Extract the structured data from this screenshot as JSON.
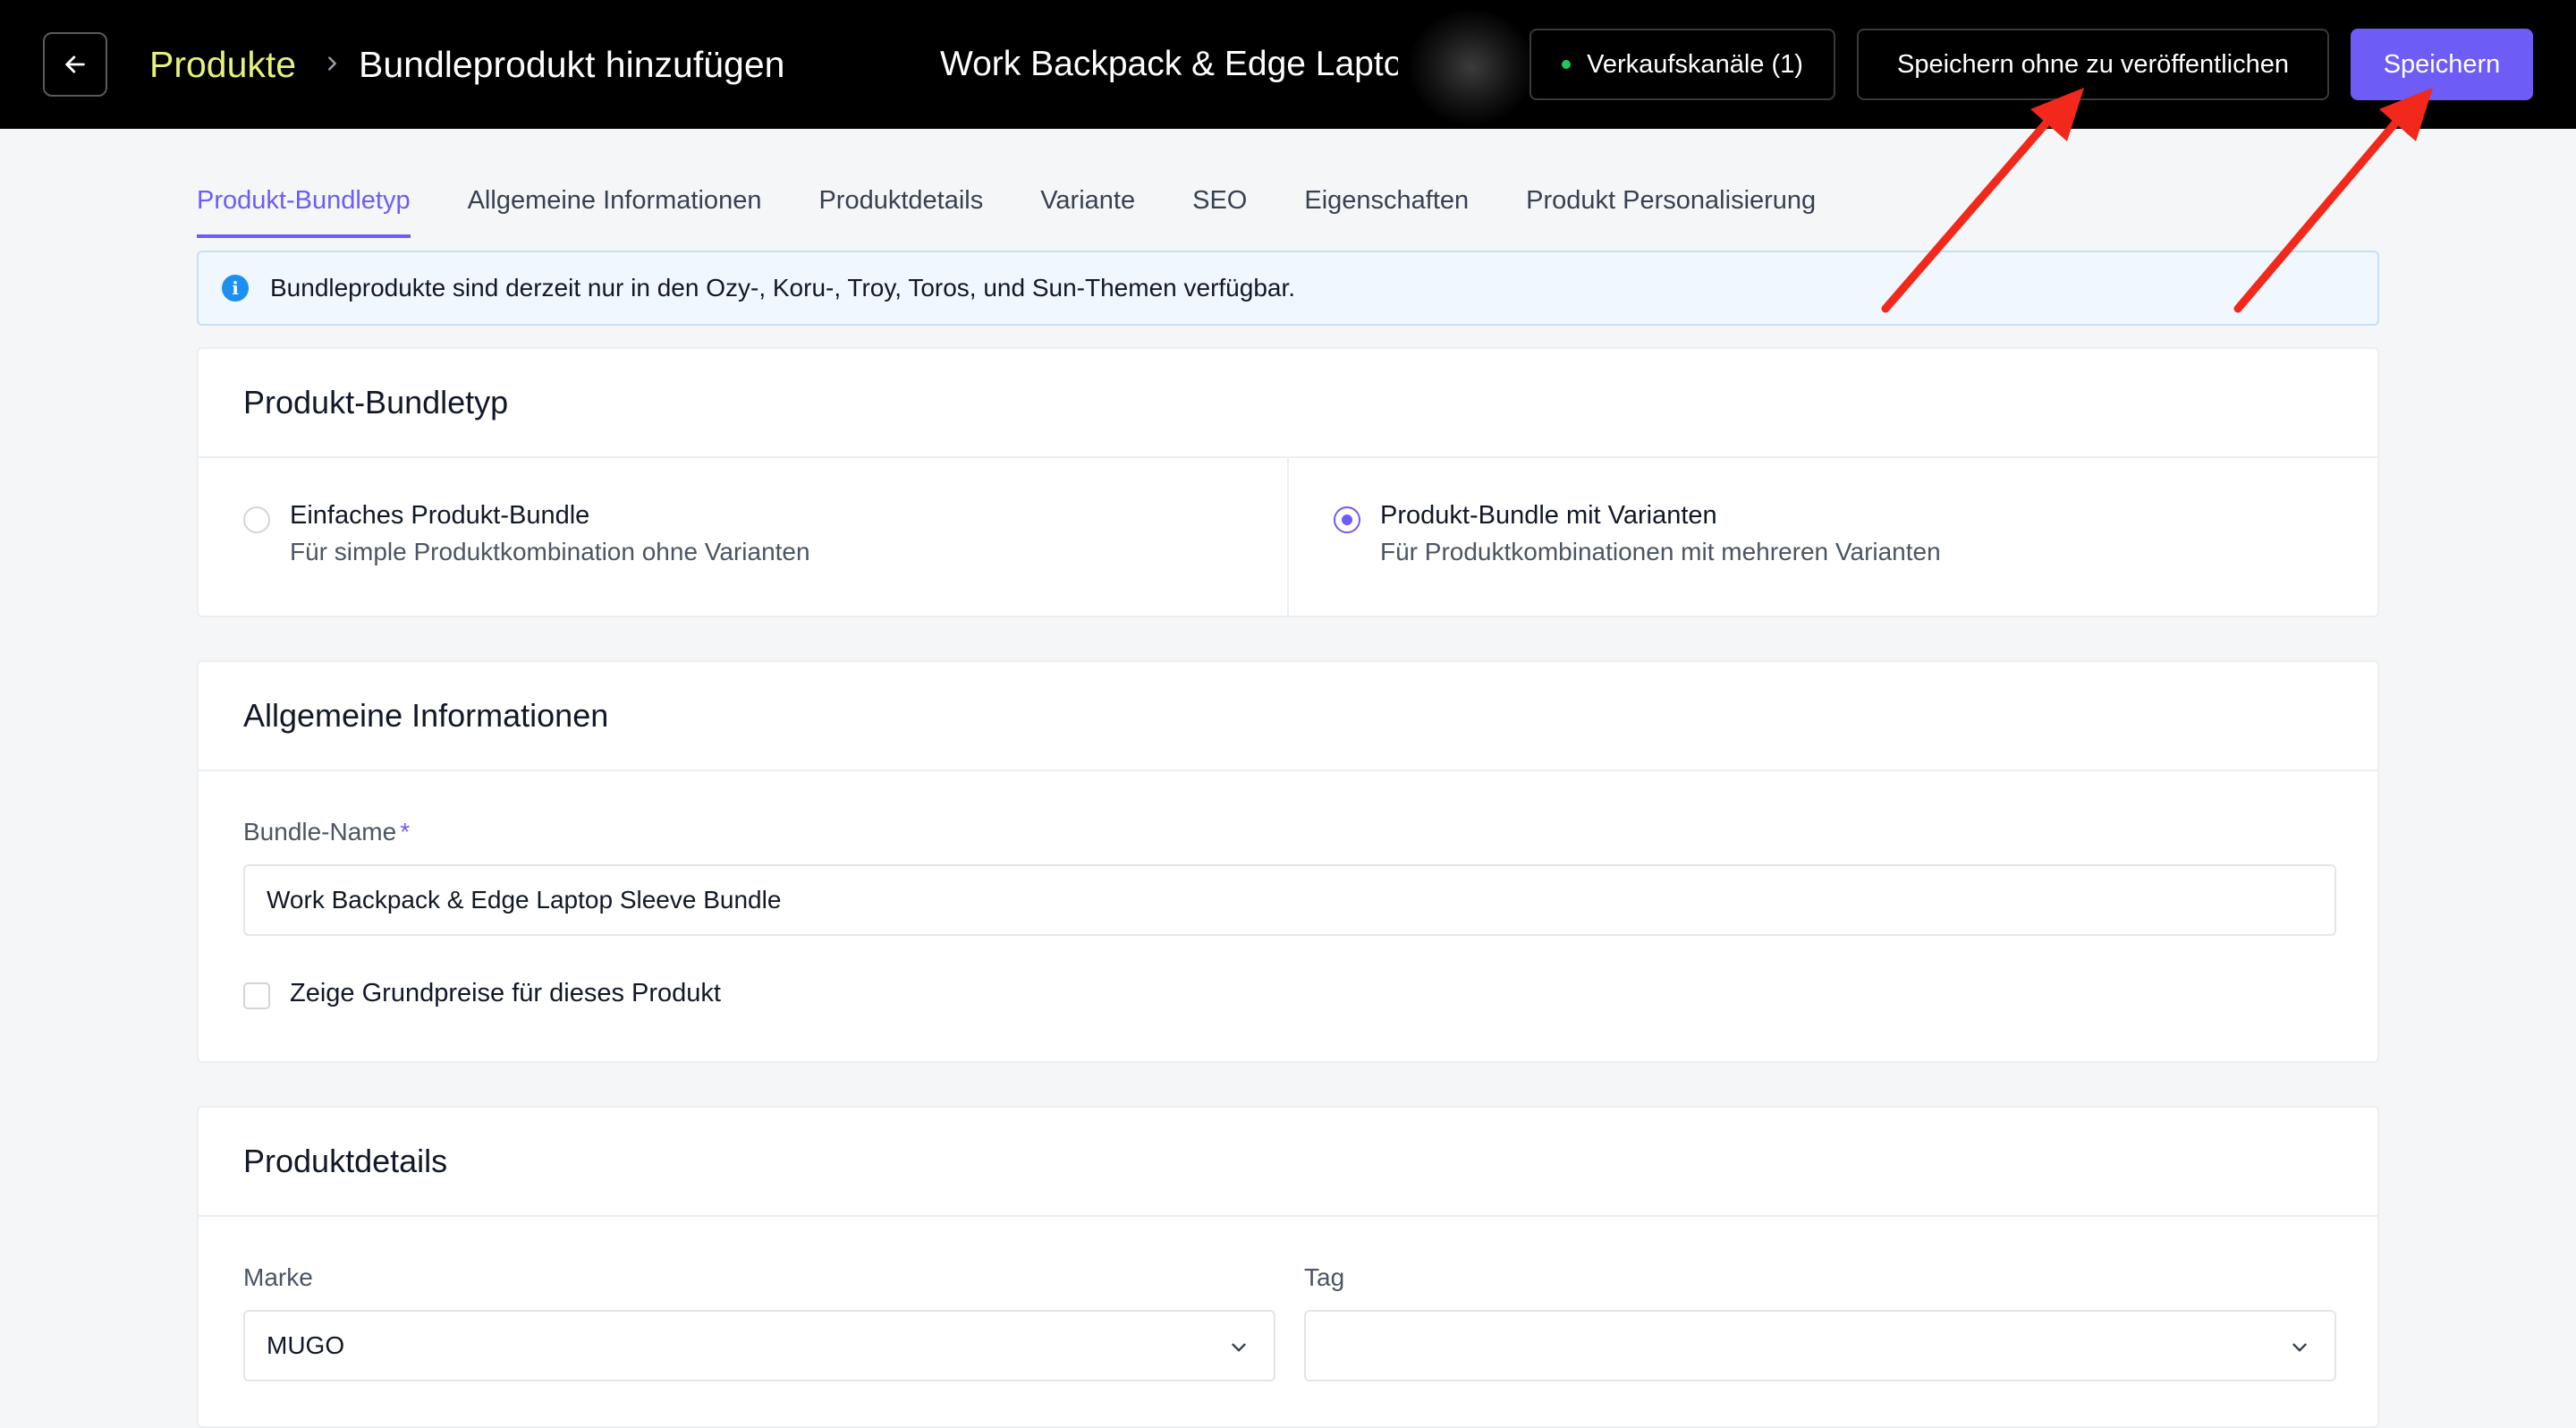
{
  "header": {
    "breadcrumb_root": "Produkte",
    "breadcrumb_current": "Bundleprodukt hinzufügen",
    "product_title": "Work Backpack & Edge Lapto",
    "channels_label": "Verkaufskanäle (1)",
    "save_draft_label": "Speichern ohne zu veröffentlichen",
    "save_label": "Speichern"
  },
  "tabs": [
    {
      "label": "Produkt-Bundletyp",
      "active": true
    },
    {
      "label": "Allgemeine Informationen"
    },
    {
      "label": "Produktdetails"
    },
    {
      "label": "Variante"
    },
    {
      "label": "SEO"
    },
    {
      "label": "Eigenschaften"
    },
    {
      "label": "Produkt Personalisierung"
    }
  ],
  "banner": {
    "icon": "info-icon",
    "text": "Bundleprodukte sind derzeit nur in den Ozy-, Koru-, Troy, Toros, und Sun-Themen verfügbar."
  },
  "bundle_type": {
    "title": "Produkt-Bundletyp",
    "options": [
      {
        "label": "Einfaches Produkt-Bundle",
        "description": "Für simple Produktkombination ohne Varianten",
        "selected": false
      },
      {
        "label": "Produkt-Bundle mit Varianten",
        "description": "Für Produktkombinationen mit mehreren Varianten",
        "selected": true
      }
    ]
  },
  "general": {
    "title": "Allgemeine Informationen",
    "name_label": "Bundle-Name",
    "required_mark": "*",
    "name_value": "Work Backpack & Edge Laptop Sleeve Bundle",
    "base_price_label": "Zeige Grundpreise für dieses Produkt",
    "base_price_checked": false
  },
  "details": {
    "title": "Produktdetails",
    "brand_label": "Marke",
    "brand_value": "MUGO",
    "tag_label": "Tag",
    "tag_value": ""
  },
  "colors": {
    "accent": "#6d5cf6",
    "breadcrumb_root": "#e6f07a",
    "annotation_arrow": "#f2281a",
    "status_dot": "#22c55e"
  }
}
